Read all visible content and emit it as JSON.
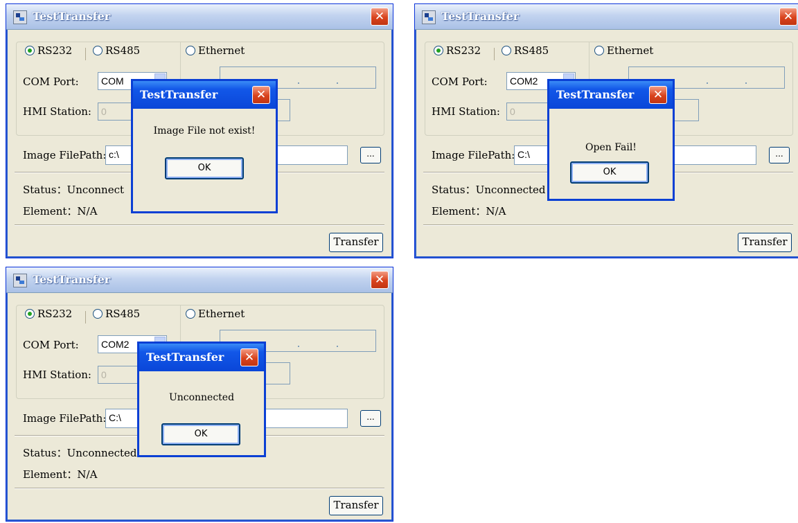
{
  "windows": [
    {
      "title": "TestTransfer",
      "radio_rs232": "RS232",
      "radio_rs485": "RS485",
      "radio_ethernet": "Ethernet",
      "com_port_label": "COM Port:",
      "com_port_value": "COM",
      "hmi_station_label": "HMI Station:",
      "hmi_station_value": "0",
      "image_filepath_label": "Image FilePath:",
      "image_filepath_value": "c:\\",
      "browse_label": "...",
      "status_text": "Status：Unconnect",
      "element_text": "Element：N/A",
      "transfer_label": "Transfer",
      "dialog": {
        "title": "TestTransfer",
        "message": "Image File not exist!",
        "ok_label": "OK"
      }
    },
    {
      "title": "TestTransfer",
      "radio_rs232": "RS232",
      "radio_rs485": "RS485",
      "radio_ethernet": "Ethernet",
      "com_port_label": "COM Port:",
      "com_port_value": "COM2",
      "hmi_station_label": "HMI Station:",
      "hmi_station_value": "0",
      "image_filepath_label": "Image FilePath:",
      "image_filepath_value": "C:\\",
      "browse_label": "...",
      "status_text": "Status：Unconnected",
      "element_text": "Element：N/A",
      "transfer_label": "Transfer",
      "dialog": {
        "title": "TestTransfer",
        "message": "Open Fail!",
        "ok_label": "OK"
      }
    },
    {
      "title": "TestTransfer",
      "radio_rs232": "RS232",
      "radio_rs485": "RS485",
      "radio_ethernet": "Ethernet",
      "com_port_label": "COM Port:",
      "com_port_value": "COM2",
      "hmi_station_label": "HMI Station:",
      "hmi_station_value": "0",
      "image_filepath_label": "Image FilePath:",
      "image_filepath_value": "C:\\",
      "browse_label": "...",
      "status_text": "Status：Unconnected",
      "element_text": "Element：N/A",
      "transfer_label": "Transfer",
      "dialog": {
        "title": "TestTransfer",
        "message": "Unconnected",
        "ok_label": "OK"
      }
    }
  ],
  "colors": {
    "window_bg": "#ece9d8",
    "title_gradient_light": "#eaf1fb",
    "title_gradient_dark": "#aac1e6",
    "dialog_title_blue": "#0a46d8",
    "close_red": "#d9431d",
    "radio_selected_green": "#21a121"
  },
  "icons": [
    "app-icon",
    "close-icon",
    "radio-selected",
    "radio-unselected"
  ]
}
